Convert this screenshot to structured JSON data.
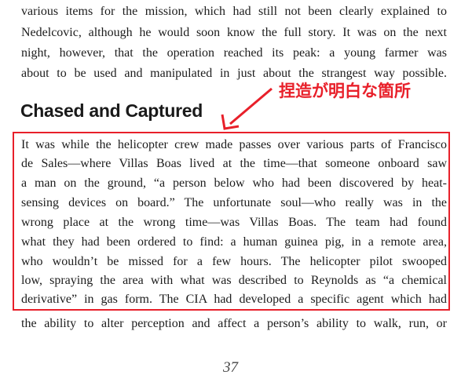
{
  "top_paragraph": [
    "various items for the mission, which had still not been clearly explained to",
    "Nedelcovic, although he would soon know the full story. It was on the next",
    "night, however, that the operation reached its peak: a young farmer was",
    "about to be used and manipulated in just about the strangest way possible."
  ],
  "annotation": {
    "label": "捏造が明白な箇所",
    "color": "#e8202a"
  },
  "section_heading": "Chased and Captured",
  "highlighted_paragraph": [
    "It was while the helicopter crew made passes over various parts of Francisco",
    "de Sales—where Villas Boas lived at the time—that someone onboard saw",
    "a man on the ground, “a person below who had been discovered by heat-",
    "sensing devices on board.” The unfortunate soul—who really was in the",
    "wrong place at the wrong time—was Villas Boas. The team had found",
    "what they had been ordered to find: a human guinea pig, in a remote area,",
    "who wouldn’t be missed for a few hours. The helicopter pilot swooped",
    "low, spraying the area with what was described to Reynolds as “a chemical",
    "derivative” in gas form. The CIA had developed a specific agent which had"
  ],
  "trailing_line": "the ability to alter perception and affect a person’s ability to walk, run, or",
  "page_number": "37"
}
